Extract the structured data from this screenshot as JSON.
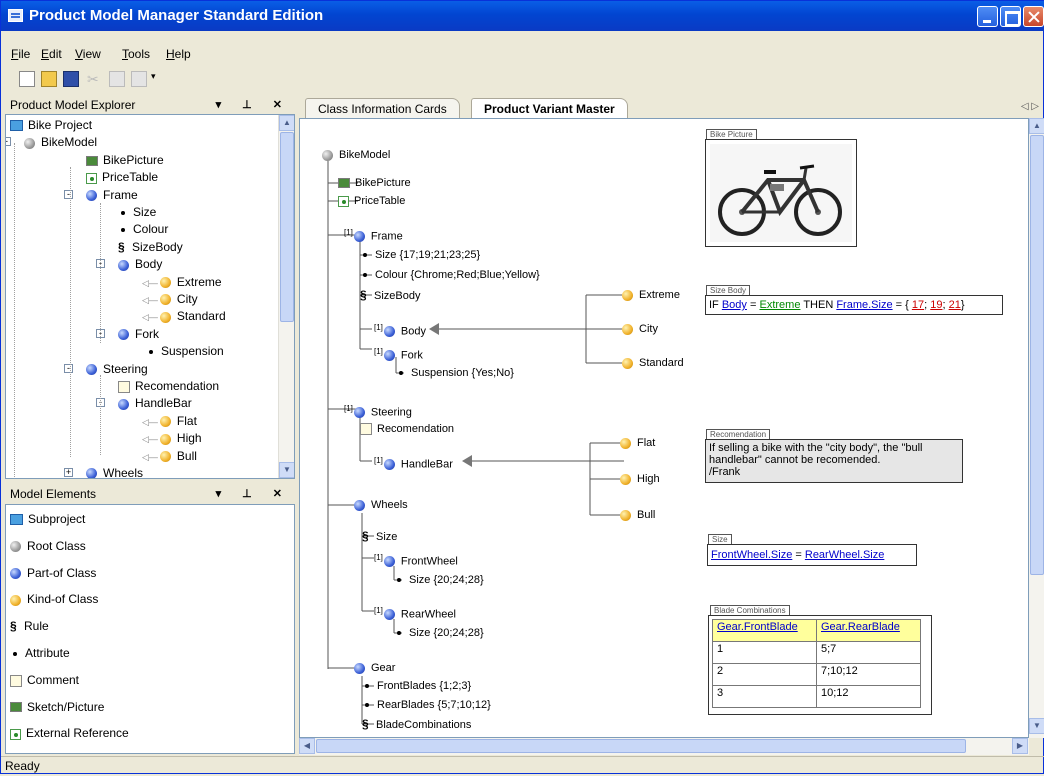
{
  "window": {
    "title": "Product Model Manager Standard Edition"
  },
  "menu": [
    "File",
    "Edit",
    "View",
    "Tools",
    "Help"
  ],
  "menu_mnemonic": [
    "F",
    "E",
    "V",
    "T",
    "H"
  ],
  "explorer": {
    "title": "Product Model Explorer",
    "tree": [
      "Bike Project",
      "BikeModel",
      "BikePicture",
      "PriceTable",
      "Frame",
      "Size",
      "Colour",
      "SizeBody",
      "Body",
      "Extreme",
      "City",
      "Standard",
      "Fork",
      "Suspension",
      "Steering",
      "Recomendation",
      "HandleBar",
      "Flat",
      "High",
      "Bull",
      "Wheels"
    ]
  },
  "elements": {
    "title": "Model Elements",
    "items": [
      "Subproject",
      "Root Class",
      "Part-of Class",
      "Kind-of Class",
      "Rule",
      "Attribute",
      "Comment",
      "Sketch/Picture",
      "External Reference"
    ]
  },
  "tabs": [
    "Class Information Cards",
    "Product Variant Master"
  ],
  "active_tab": 1,
  "diagram": {
    "root": "BikeModel",
    "bikepicture": "BikePicture",
    "pricetable": "PriceTable",
    "mult": "[1]",
    "frame": "Frame",
    "frame_size": "Size {17;19;21;23;25}",
    "frame_colour": "Colour {Chrome;Red;Blue;Yellow}",
    "sizebody": "SizeBody",
    "body": "Body",
    "fork": "Fork",
    "suspension": "Suspension {Yes;No}",
    "extreme": "Extreme",
    "city": "City",
    "standard": "Standard",
    "steering": "Steering",
    "recomendation": "Recomendation",
    "handlebar": "HandleBar",
    "flat": "Flat",
    "high": "High",
    "bull": "Bull",
    "wheels": "Wheels",
    "wheels_size": "Size",
    "frontwheel": "FrontWheel",
    "frontwheel_size": "Size {20;24;28}",
    "rearwheel": "RearWheel",
    "rearwheel_size": "Size {20;24;28}",
    "gear": "Gear",
    "frontblades": "FrontBlades {1;2;3}",
    "rearblades": "RearBlades {5;7;10;12}",
    "bladecombinations": "BladeCombinations"
  },
  "notes": {
    "bikepicture_label": "Bike Picture",
    "sizebody_label": "Size Body",
    "sizebody": {
      "if": "IF",
      "body": "Body",
      "eq1": "=",
      "extreme": "Extreme",
      "then": "THEN",
      "framesize": "Frame.Size",
      "eq2": "= {",
      "v1": "17",
      "sep1": ";",
      "v2": "19",
      "sep2": ";",
      "v3": "21",
      "close": "}"
    },
    "recomendation_label": "Recomendation",
    "recomendation_text": [
      "If selling a bike with the \"city body\", the \"bull",
      "handlebar\" cannot be recomended.",
      "/Frank"
    ],
    "size_label": "Size",
    "size_rule": {
      "left": "FrontWheel.Size",
      "eq": "=",
      "right": "RearWheel.Size"
    },
    "blade_label": "Blade Combinations",
    "blade_table": {
      "headers": [
        "Gear.FrontBlade",
        "Gear.RearBlade"
      ],
      "rows": [
        [
          "1",
          "5;7"
        ],
        [
          "2",
          "7;10;12"
        ],
        [
          "3",
          "10;12"
        ]
      ]
    }
  },
  "status": "Ready"
}
